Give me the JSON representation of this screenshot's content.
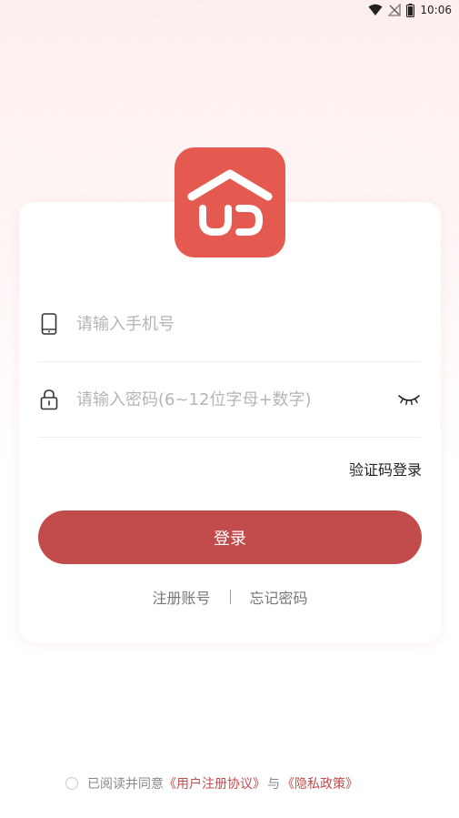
{
  "status_bar": {
    "time": "10:06",
    "icons": [
      "wifi-icon",
      "no-signal-icon",
      "battery-icon"
    ]
  },
  "logo": {
    "icon": "house-logo-icon",
    "color": "#e55a50"
  },
  "phone_field": {
    "icon": "phone-icon",
    "placeholder": "请输入手机号",
    "value": ""
  },
  "password_field": {
    "icon": "lock-icon",
    "placeholder": "请输入密码(6~12位字母+数字)",
    "value": "",
    "toggle_icon": "eye-closed-icon"
  },
  "code_login_label": "验证码登录",
  "login_button_label": "登录",
  "links": {
    "register": "注册账号",
    "forgot": "忘记密码"
  },
  "agreement": {
    "prefix": "已阅读并同意",
    "user_agreement": "《用户注册协议》",
    "conjunction": "与",
    "privacy_policy": "《隐私政策》",
    "checked": false
  },
  "colors": {
    "accent": "#c24c4c",
    "logo_bg": "#e55a50"
  }
}
